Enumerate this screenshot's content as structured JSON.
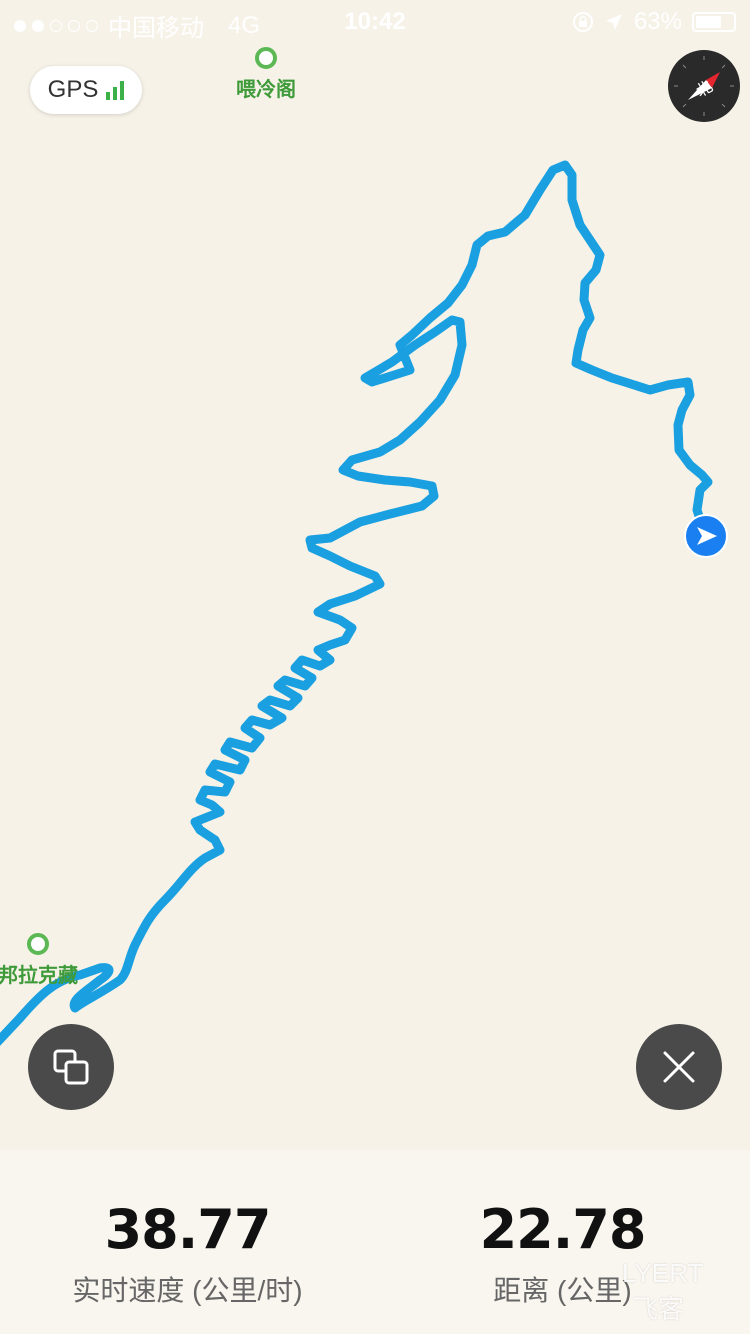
{
  "status_bar": {
    "carrier": "中国移动",
    "network": "4G",
    "time": "10:42",
    "battery": "63%",
    "battery_level": 0.63,
    "signal_dots_filled": 2,
    "signal_dots_total": 5
  },
  "map": {
    "gps_label": "GPS",
    "gps_signal_color": "#3cb14a",
    "route_color": "#1aa0e0",
    "poi_top_label": "喂冷阁",
    "poi_left_label": "邦拉克藏",
    "compass_label": "北",
    "location_marker_color": "#1a7ff0"
  },
  "stats": {
    "speed_value": "38.77",
    "speed_label": "实时速度 (公里/时)",
    "distance_value": "22.78",
    "distance_label": "距离 (公里)"
  },
  "watermark": {
    "latin": "LYERT",
    "chinese": "飞客"
  }
}
